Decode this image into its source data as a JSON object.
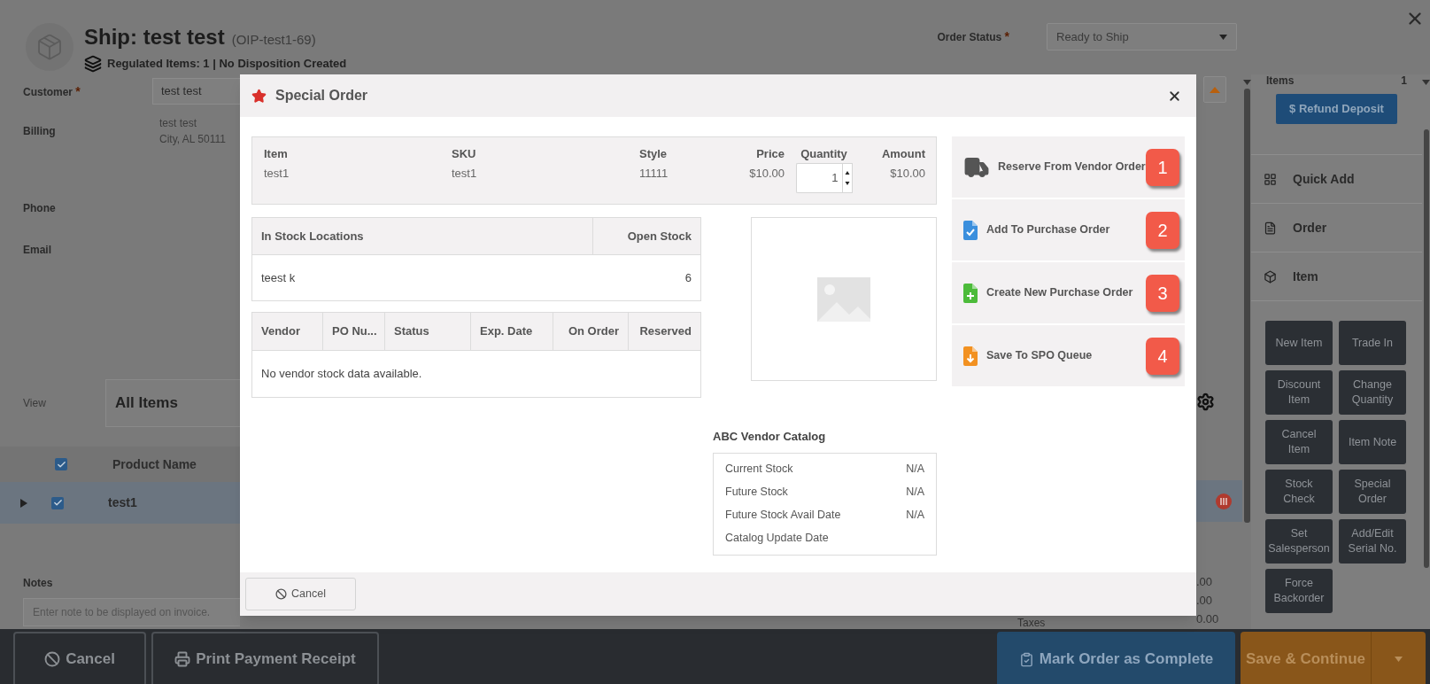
{
  "header": {
    "title": "Ship: test test",
    "order_number": "(OIP-test1-69)",
    "regulated_info": "Regulated Items: 1 | No Disposition Created",
    "order_status": {
      "label": "Order Status",
      "required_mark": "*",
      "value": "Ready to Ship"
    }
  },
  "customer_form": {
    "customer": {
      "label": "Customer",
      "required_mark": "*",
      "value": "test test"
    },
    "billing": {
      "label": "Billing",
      "lines": [
        "test test",
        "City, AL 50111"
      ]
    },
    "phone_label": "Phone",
    "email_label": "Email"
  },
  "view": {
    "label": "View",
    "value": "All Items"
  },
  "items_table": {
    "header": {
      "checked": true,
      "column": "Product Name"
    },
    "rows": [
      {
        "name": "test1",
        "checked": true,
        "selected": true,
        "expanded": false
      }
    ]
  },
  "notes": {
    "label": "Notes",
    "placeholder": "Enter note to be displayed on invoice."
  },
  "totals": {
    "values": [
      ".00",
      ".00"
    ],
    "taxes": {
      "label": "Taxes",
      "value": "0.00"
    }
  },
  "side_panel": {
    "items": {
      "label": "Items",
      "value": "1"
    },
    "refund_button": "$ Refund Deposit",
    "sections": [
      "Quick Add",
      "Order",
      "Item"
    ],
    "actions": [
      "New Item",
      "Trade In",
      "Discount Item",
      "Change Quantity",
      "Cancel Item",
      "Item Note",
      "Stock Check",
      "Special Order",
      "Set Salesperson",
      "Add/Edit Serial No.",
      "Force Backorder"
    ]
  },
  "footer": {
    "left_buttons": [
      "Cancel",
      "Print Payment Receipt"
    ],
    "complete_button": "Mark Order as Complete",
    "save_button": "Save & Continue"
  },
  "modal": {
    "title": "Special Order",
    "item_table": {
      "columns": [
        "Item",
        "SKU",
        "Style",
        "Price",
        "Quantity",
        "Amount"
      ],
      "row": {
        "item": "test1",
        "sku": "test1",
        "style": "11111",
        "price": "$10.00",
        "quantity": "1",
        "amount": "$10.00"
      }
    },
    "stock_locations": {
      "columns": [
        "In Stock Locations",
        "Open Stock"
      ],
      "rows": [
        [
          "teest k",
          "6"
        ]
      ]
    },
    "vendor_stock": {
      "columns": [
        "Vendor",
        "PO Nu...",
        "Status",
        "Exp. Date",
        "On Order",
        "Reserved"
      ],
      "empty_message": "No vendor stock data available."
    },
    "catalog": {
      "title": "ABC Vendor Catalog",
      "rows": [
        {
          "label": "Current Stock",
          "value": "N/A"
        },
        {
          "label": "Future Stock",
          "value": "N/A"
        },
        {
          "label": "Future Stock Avail Date",
          "value": "N/A"
        },
        {
          "label": "Catalog Update Date"
        }
      ]
    },
    "actions": [
      {
        "label": "Reserve From Vendor Order",
        "badge": "1"
      },
      {
        "label": "Add To Purchase Order",
        "badge": "2",
        "color": "#3b8fdd"
      },
      {
        "label": "Create New Purchase Order",
        "badge": "3",
        "color": "#4cbb3a"
      },
      {
        "label": "Save To SPO Queue",
        "badge": "4",
        "color": "#f29121"
      }
    ],
    "cancel_button": "Cancel"
  }
}
